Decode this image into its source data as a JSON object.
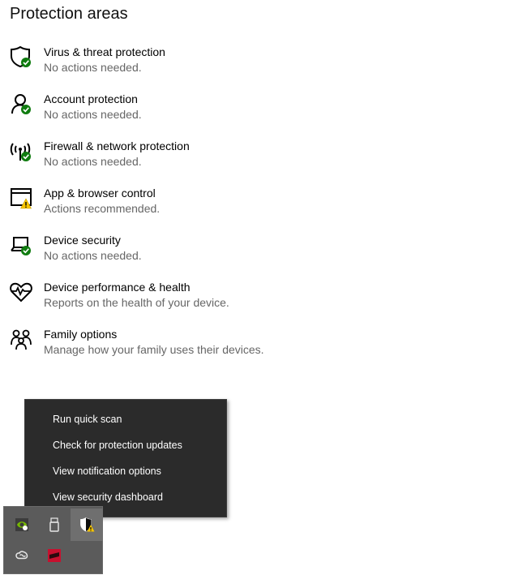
{
  "page": {
    "heading": "Protection areas"
  },
  "areas": [
    {
      "icon": "shield-check-icon",
      "title": "Virus & threat protection",
      "status": "No actions needed."
    },
    {
      "icon": "account-check-icon",
      "title": "Account protection",
      "status": "No actions needed."
    },
    {
      "icon": "wifi-check-icon",
      "title": "Firewall & network protection",
      "status": "No actions needed."
    },
    {
      "icon": "browser-warning-icon",
      "title": "App & browser control",
      "status": "Actions recommended."
    },
    {
      "icon": "laptop-check-icon",
      "title": "Device security",
      "status": "No actions needed."
    },
    {
      "icon": "heart-pulse-icon",
      "title": "Device performance & health",
      "status": "Reports on the health of your device."
    },
    {
      "icon": "family-icon",
      "title": "Family options",
      "status": "Manage how your family uses their devices."
    }
  ],
  "context_menu": {
    "items": [
      {
        "label": "Run quick scan"
      },
      {
        "label": "Check for protection updates"
      },
      {
        "label": "View notification options"
      },
      {
        "label": "View security dashboard"
      }
    ]
  },
  "tray": {
    "icons": [
      "nvidia-icon",
      "usb-drive-icon",
      "security-shield-warning-icon",
      "creative-cloud-icon",
      "red-app-icon"
    ]
  },
  "colors": {
    "ok": "#107c10",
    "warning": "#f8c600",
    "menu_bg": "#2b2b2b",
    "tray_bg": "#5b5b5b",
    "status_text": "#666666"
  }
}
